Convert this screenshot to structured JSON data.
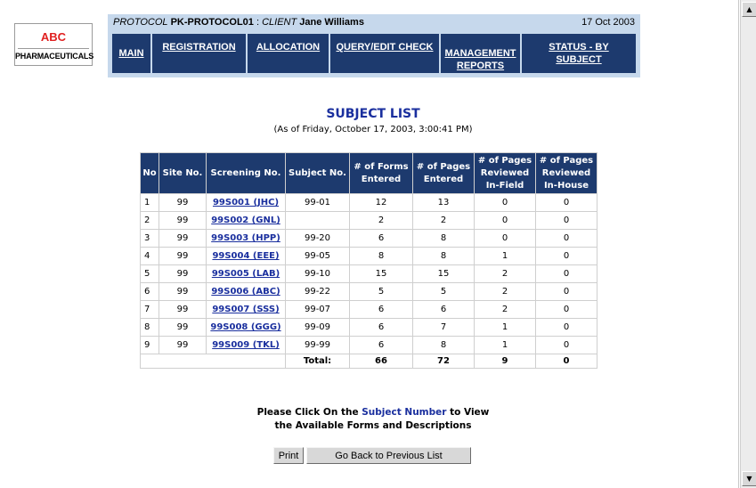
{
  "logo": {
    "line1": "ABC",
    "line2": "PHARMACEUTICALS"
  },
  "header": {
    "protocol_label": "PROTOCOL",
    "protocol_value": "PK-PROTOCOL01",
    "separator": ":",
    "client_label": "CLIENT",
    "client_value": "Jane Williams",
    "date": "17 Oct 2003"
  },
  "nav": [
    {
      "l1": "MAIN",
      "l2": ""
    },
    {
      "l1": "REGISTRATION",
      "l2": ""
    },
    {
      "l1": "ALLOCATION",
      "l2": ""
    },
    {
      "l1": "QUERY/EDIT CHECK",
      "l2": ""
    },
    {
      "l1": "MANAGEMENT",
      "l2": "REPORTS"
    },
    {
      "l1": "STATUS - BY",
      "l2": "SUBJECT"
    }
  ],
  "title": "SUBJECT LIST",
  "subtitle": "(As of Friday, October 17, 2003, 3:00:41 PM)",
  "table": {
    "headers": [
      [
        "No"
      ],
      [
        "Site No."
      ],
      [
        "Screening No."
      ],
      [
        "Subject No."
      ],
      [
        "# of Forms",
        "Entered"
      ],
      [
        "# of Pages",
        "Entered"
      ],
      [
        "# of Pages",
        "Reviewed",
        "In-Field"
      ],
      [
        "# of Pages",
        "Reviewed",
        "In-House"
      ]
    ],
    "rows": [
      [
        "1",
        "99",
        "99S001 (JHC)",
        "99-01",
        "12",
        "13",
        "0",
        "0"
      ],
      [
        "2",
        "99",
        "99S002 (GNL)",
        "",
        "2",
        "2",
        "0",
        "0"
      ],
      [
        "3",
        "99",
        "99S003 (HPP)",
        "99-20",
        "6",
        "8",
        "0",
        "0"
      ],
      [
        "4",
        "99",
        "99S004 (EEE)",
        "99-05",
        "8",
        "8",
        "1",
        "0"
      ],
      [
        "5",
        "99",
        "99S005 (LAB)",
        "99-10",
        "15",
        "15",
        "2",
        "0"
      ],
      [
        "6",
        "99",
        "99S006 (ABC)",
        "99-22",
        "5",
        "5",
        "2",
        "0"
      ],
      [
        "7",
        "99",
        "99S007 (SSS)",
        "99-07",
        "6",
        "6",
        "2",
        "0"
      ],
      [
        "8",
        "99",
        "99S008 (GGG)",
        "99-09",
        "6",
        "7",
        "1",
        "0"
      ],
      [
        "9",
        "99",
        "99S009 (TKL)",
        "99-99",
        "6",
        "8",
        "1",
        "0"
      ]
    ],
    "total": {
      "label": "Total:",
      "forms": "66",
      "pages": "72",
      "infield": "9",
      "inhouse": "0"
    }
  },
  "note": {
    "part1": "Please Click On the",
    "link": "Subject Number",
    "part2": "to View",
    "line2": "the Available Forms and Descriptions"
  },
  "buttons": {
    "print": "Print",
    "back": "Go Back to Previous List"
  }
}
